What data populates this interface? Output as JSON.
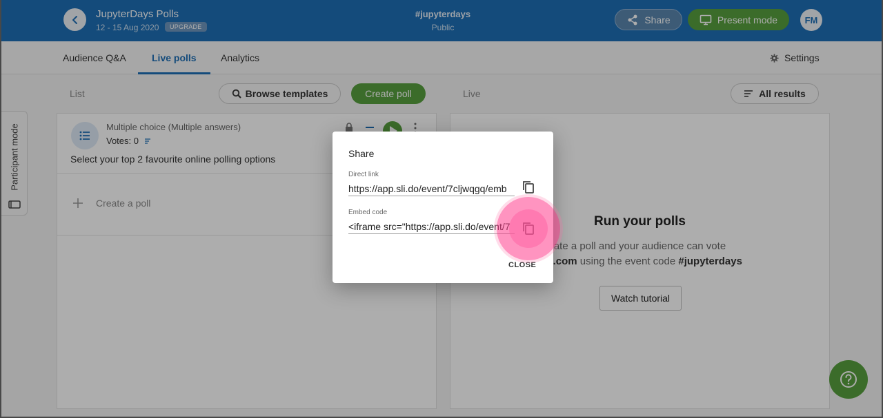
{
  "header": {
    "event_title": "JupyterDays Polls",
    "event_dates": "12 - 15 Aug 2020",
    "upgrade_badge": "UPGRADE",
    "event_code": "#jupyterdays",
    "privacy": "Public",
    "share_label": "Share",
    "present_label": "Present mode",
    "avatar_initials": "FM"
  },
  "tabs": [
    {
      "label": "Audience Q&A",
      "active": false
    },
    {
      "label": "Live polls",
      "active": true
    },
    {
      "label": "Analytics",
      "active": false
    }
  ],
  "settings_label": "Settings",
  "toolbar": {
    "list_label": "List",
    "browse_templates": "Browse templates",
    "create_poll": "Create poll",
    "live_label": "Live",
    "all_results": "All results"
  },
  "participant_mode_label": "Participant mode",
  "poll": {
    "type": "Multiple choice (Multiple answers)",
    "votes": "Votes: 0",
    "question": "Select your top 2 favourite online polling options"
  },
  "create_row_label": "Create a poll",
  "right_panel": {
    "title": "Run your polls",
    "subtitle_line1": "ate a poll and your audience can vote",
    "subtitle_line2_bold1": "ido.com",
    "subtitle_line2_mid": " using the event code ",
    "subtitle_line2_bold2": "#jupyterdays",
    "watch_tutorial": "Watch tutorial"
  },
  "dialog": {
    "title": "Share",
    "direct_link_label": "Direct link",
    "direct_link_value": "https://app.sli.do/event/7cljwqgq/emb",
    "embed_code_label": "Embed code",
    "embed_code_value": "<iframe src=\"https://app.sli.do/event/7",
    "close_label": "CLOSE"
  },
  "colors": {
    "brand_blue": "#1e6fb6",
    "accent_green": "#58a03e",
    "highlight_pink": "#ff3c8c"
  }
}
